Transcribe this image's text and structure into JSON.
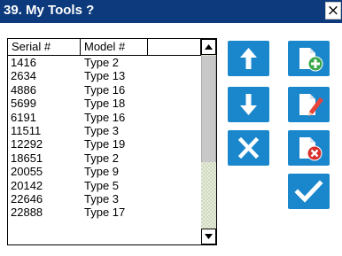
{
  "window": {
    "title": "39. My Tools ?",
    "close_label": "×",
    "titlebar_color": "#0c3a7c"
  },
  "tool_list": {
    "columns": [
      "Serial #",
      "Model #"
    ],
    "rows": [
      {
        "serial": "1416",
        "model": "Type 2"
      },
      {
        "serial": "2634",
        "model": "Type 13"
      },
      {
        "serial": "4886",
        "model": "Type 16"
      },
      {
        "serial": "5699",
        "model": "Type 18"
      },
      {
        "serial": "6191",
        "model": "Type 16"
      },
      {
        "serial": "11511",
        "model": "Type 3"
      },
      {
        "serial": "12292",
        "model": "Type 19"
      },
      {
        "serial": "18651",
        "model": "Type 2"
      },
      {
        "serial": "20055",
        "model": "Type 9"
      },
      {
        "serial": "20142",
        "model": "Type 5"
      },
      {
        "serial": "22646",
        "model": "Type 3"
      },
      {
        "serial": "22888",
        "model": "Type 17"
      }
    ]
  },
  "buttons": {
    "accent_color": "#1a87cc",
    "move_up": "arrow-up-icon",
    "move_down": "arrow-down-icon",
    "delete": "x-icon",
    "add_tool": "document-plus-icon",
    "edit_tool": "document-edit-icon",
    "remove_tool": "document-remove-icon",
    "confirm": "checkmark-icon"
  }
}
